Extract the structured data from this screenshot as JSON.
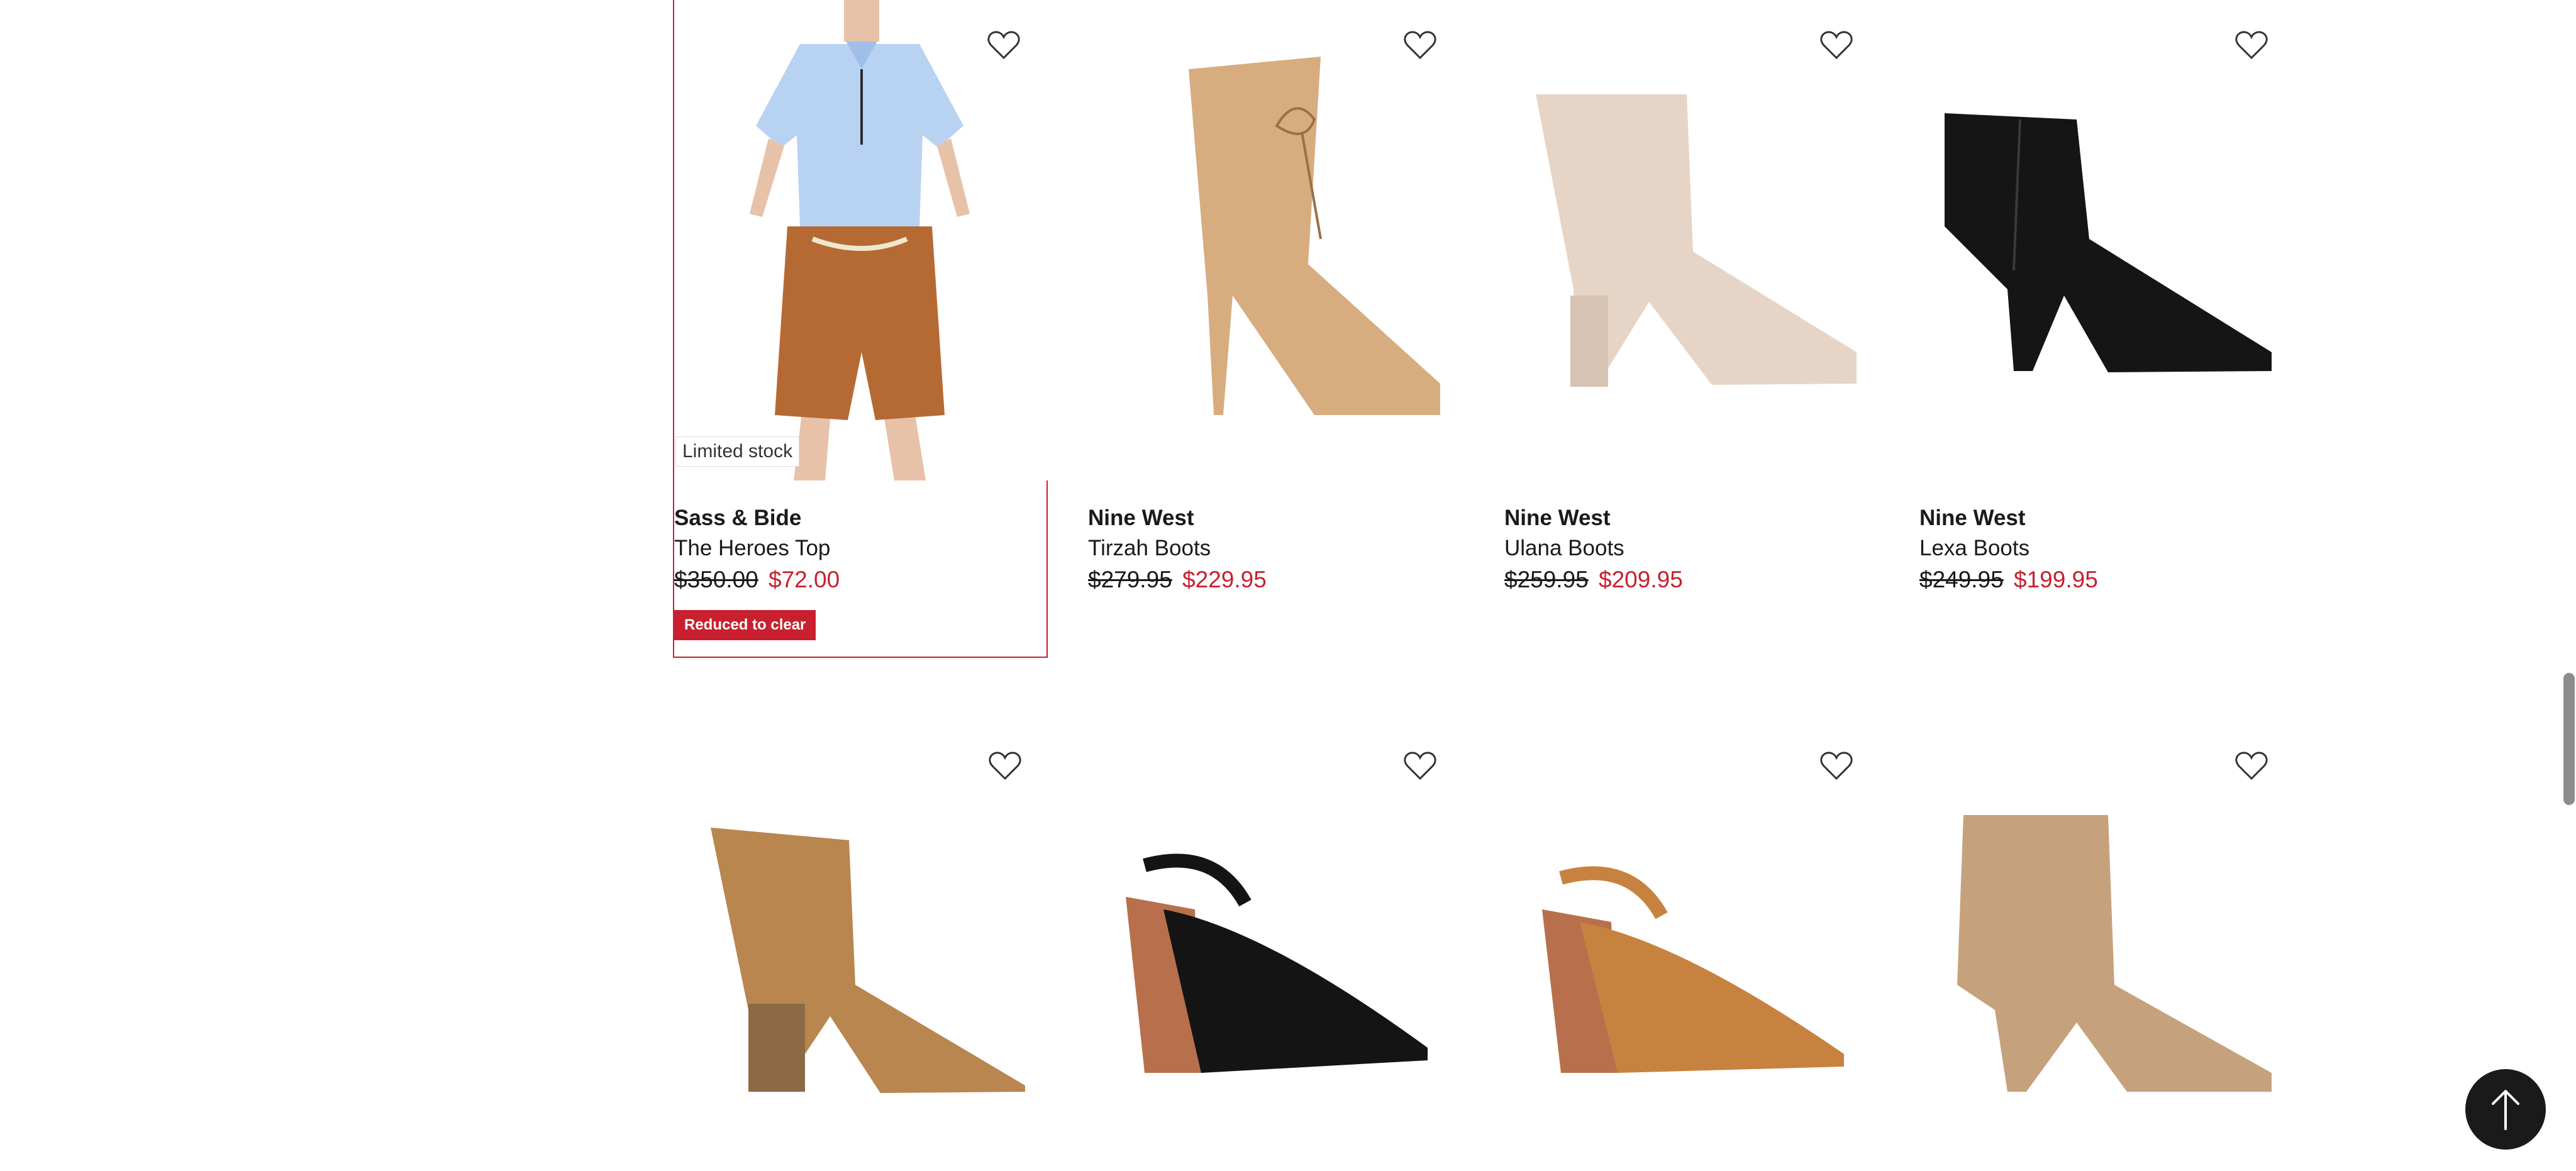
{
  "products": [
    {
      "brand": "Sass & Bide",
      "name": "The Heroes Top",
      "was": "$350.00",
      "now": "$72.00",
      "stock": "Limited stock",
      "badge": "Reduced to clear"
    },
    {
      "brand": "Nine West",
      "name": "Tirzah Boots",
      "was": "$279.95",
      "now": "$229.95"
    },
    {
      "brand": "Nine West",
      "name": "Ulana Boots",
      "was": "$259.95",
      "now": "$209.95"
    },
    {
      "brand": "Nine West",
      "name": "Lexa Boots",
      "was": "$249.95",
      "now": "$199.95"
    }
  ],
  "icons": {
    "wishlist": "heart-icon",
    "back_to_top": "arrow-up-icon"
  },
  "colors": {
    "sale": "#c8202f",
    "button": "#1a1a1a"
  }
}
